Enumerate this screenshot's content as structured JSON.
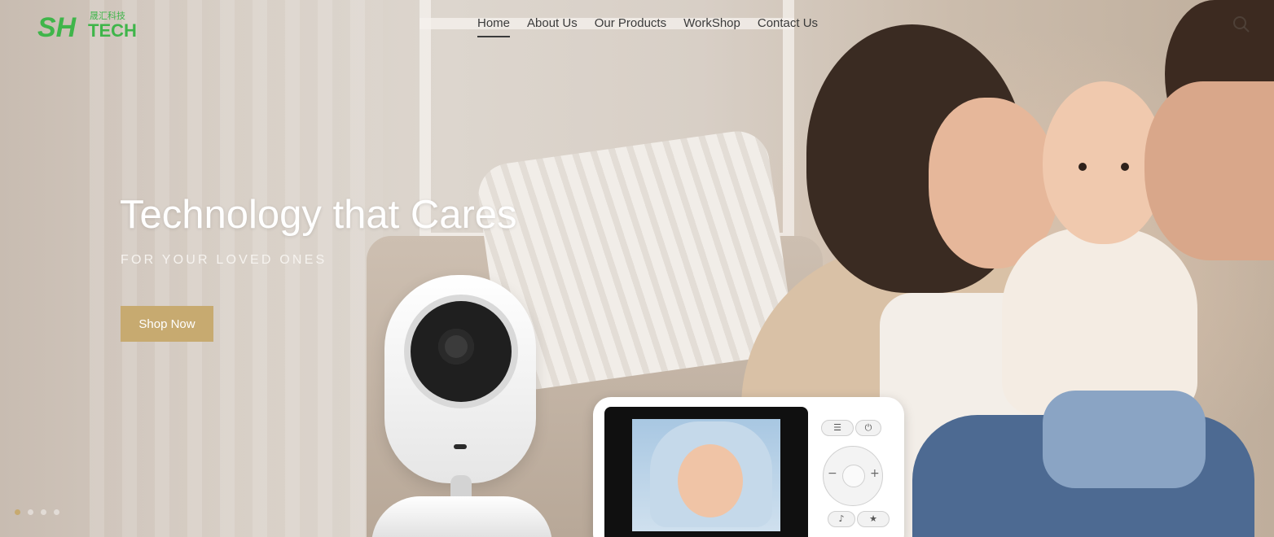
{
  "brand": {
    "logo_text": "SH",
    "logo_sub": "TECH",
    "logo_cn": "晟汇科技",
    "color": "#3fb54a"
  },
  "nav": {
    "items": [
      {
        "label": "Home",
        "active": true
      },
      {
        "label": "About Us",
        "active": false
      },
      {
        "label": "Our Products",
        "active": false
      },
      {
        "label": "WorkShop",
        "active": false
      },
      {
        "label": "Contact Us",
        "active": false
      }
    ],
    "search_icon": "search-icon"
  },
  "hero": {
    "title": "Technology that Cares",
    "subtitle": "FOR YOUR LOVED ONES",
    "cta_label": "Shop Now",
    "accent": "#c7aa70"
  },
  "slider": {
    "slide_count": 4,
    "active_index": 0
  }
}
